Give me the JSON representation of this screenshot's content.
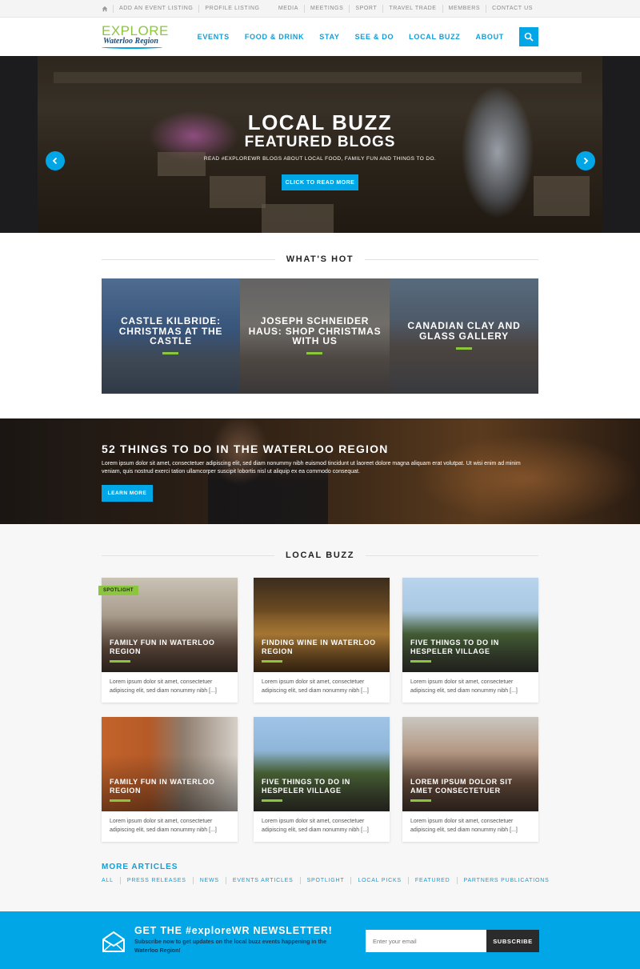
{
  "topbar": {
    "home_icon": "home-icon",
    "left_links": [
      "ADD AN EVENT LISTING",
      "PROFILE LISTING"
    ],
    "right_links": [
      "MEDIA",
      "MEETINGS",
      "SPORT",
      "TRAVEL TRADE",
      "MEMBERS",
      "CONTACT US"
    ]
  },
  "header": {
    "logo_line1": "EXPLORE",
    "logo_line2": "Waterloo Region",
    "nav": [
      "EVENTS",
      "FOOD & DRINK",
      "STAY",
      "SEE & DO",
      "LOCAL BUZZ",
      "ABOUT"
    ],
    "search_icon": "search-icon"
  },
  "hero": {
    "title_line1": "LOCAL BUZZ",
    "title_line2": "FEATURED BLOGS",
    "subtitle": "READ #EXPLOREWR BLOGS ABOUT LOCAL FOOD, FAMILY FUN AND THINGS TO DO.",
    "button": "CLICK TO READ MORE",
    "prev_icon": "chevron-left-icon",
    "next_icon": "chevron-right-icon"
  },
  "whats_hot": {
    "heading": "WHAT'S HOT",
    "items": [
      {
        "title": "CASTLE KILBRIDE: CHRISTMAS AT THE CASTLE"
      },
      {
        "title": "JOSEPH SCHNEIDER HAUS: SHOP CHRISTMAS WITH US"
      },
      {
        "title": "CANADIAN CLAY AND GLASS GALLERY"
      }
    ]
  },
  "promo": {
    "title": "52 THINGS TO DO IN THE WATERLOO REGION",
    "text": "Lorem ipsum dolor sit amet, consectetuer adipiscing elit, sed diam nonummy nibh euismod tincidunt ut laoreet dolore magna aliquam erat volutpat. Ut wisi enim ad minim veniam, quis nostrud exerci tation ullamcorper suscipit lobortis nisl ut aliquip ex ea commodo consequat.",
    "button": "LEARN MORE"
  },
  "local_buzz": {
    "heading": "LOCAL BUZZ",
    "badge": "SPOTLIGHT",
    "excerpt": "Lorem ipsum dolor sit amet, consectetuer adipiscing elit, sed diam nonummy nibh [...]",
    "cards": [
      {
        "title": "FAMILY FUN IN WATERLOO REGION"
      },
      {
        "title": "FINDING WINE IN WATERLOO REGION"
      },
      {
        "title": "FIVE THINGS TO DO IN HESPELER VILLAGE"
      },
      {
        "title": "FAMILY FUN IN WATERLOO REGION"
      },
      {
        "title": "FIVE THINGS TO DO IN HESPELER VILLAGE"
      },
      {
        "title": "LOREM IPSUM DOLOR SIT AMET CONSECTETUER"
      }
    ]
  },
  "more_articles": {
    "title": "MORE ARTICLES",
    "links": [
      "ALL",
      "PRESS RELEASES",
      "NEWS",
      "EVENTS ARTICLES",
      "SPOTLIGHT",
      "LOCAL PICKS",
      "FEATURED",
      "PARTNERS PUBLICATIONS"
    ]
  },
  "newsletter": {
    "icon": "envelope-icon",
    "title": "GET THE #exploreWR NEWSLETTER!",
    "subtitle": "Subscribe now to get updates on the local buzz events happening in the Waterloo Region!",
    "placeholder": "Enter your email",
    "button": "SUBSCRIBE"
  },
  "colors": {
    "accent_blue": "#00a6e6",
    "accent_green": "#8cc63f",
    "dark": "#2b2b2b"
  }
}
